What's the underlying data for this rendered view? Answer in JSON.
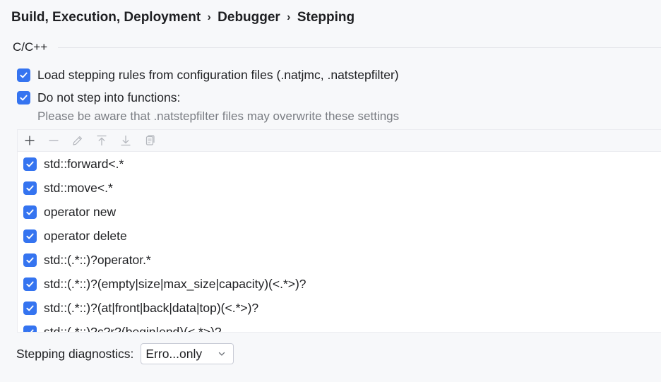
{
  "breadcrumb": {
    "items": [
      "Build, Execution, Deployment",
      "Debugger",
      "Stepping"
    ],
    "separator": "›"
  },
  "group": {
    "title": "C/C++"
  },
  "options": {
    "load_rules": {
      "label": "Load stepping rules from configuration files (.natjmc, .natstepfilter)",
      "checked": true
    },
    "do_not_step": {
      "label": "Do not step into functions:",
      "checked": true
    },
    "hint": "Please be aware that .natstepfilter files may overwrite these settings"
  },
  "toolbar": {
    "icons": [
      "add-icon",
      "remove-icon",
      "edit-icon",
      "move-up-icon",
      "move-down-icon",
      "copy-icon"
    ]
  },
  "rules": [
    {
      "pattern": "std::forward<.*",
      "checked": true
    },
    {
      "pattern": "std::move<.*",
      "checked": true
    },
    {
      "pattern": "operator new",
      "checked": true
    },
    {
      "pattern": "operator delete",
      "checked": true
    },
    {
      "pattern": "std::(.*::)?operator.*",
      "checked": true
    },
    {
      "pattern": "std::(.*::)?(empty|size|max_size|capacity)(<.*>)?",
      "checked": true
    },
    {
      "pattern": "std::(.*::)?(at|front|back|data|top)(<.*>)?",
      "checked": true
    },
    {
      "pattern": "std::(.*::)?c?r?(begin|end)(<.*>)?",
      "checked": true
    }
  ],
  "diagnostics": {
    "label": "Stepping diagnostics:",
    "value": "Erro...only"
  },
  "colors": {
    "accent": "#3574f0",
    "hint_text": "#7a7d83",
    "background": "#f7f8fa"
  }
}
